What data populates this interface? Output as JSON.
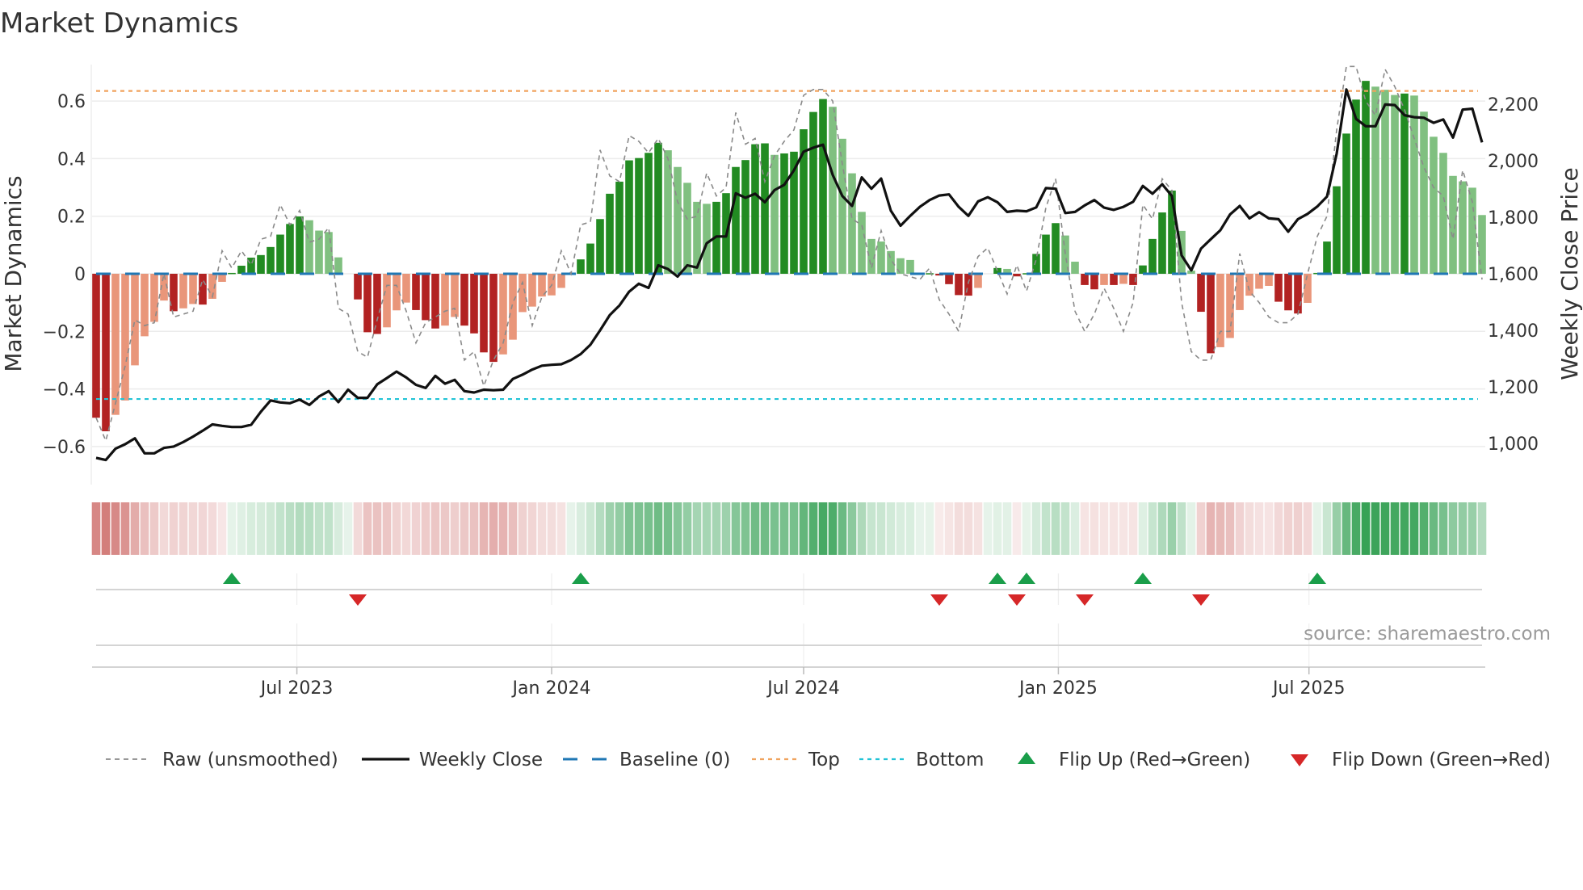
{
  "title": "Market Dynamics",
  "source": "source: sharemaestro.com",
  "chart_data": {
    "type": "bar",
    "title": "Market Dynamics",
    "ylabel": "Market Dynamics",
    "y2label": "Weekly Close Price",
    "ylim": [
      -0.7,
      0.75
    ],
    "y2lim": [
      900,
      2330
    ],
    "start_date": "2023-02-06",
    "interval": "weekly",
    "top_level": 0.635,
    "bottom_level": -0.435,
    "baseline": 0,
    "grid": "horizontal",
    "left_ticks": [
      {
        "value": -0.6,
        "label": "−0.6"
      },
      {
        "value": -0.4,
        "label": "−0.4"
      },
      {
        "value": -0.2,
        "label": "−0.2"
      },
      {
        "value": 0,
        "label": "0"
      },
      {
        "value": 0.2,
        "label": "0.2"
      },
      {
        "value": 0.4,
        "label": "0.4"
      },
      {
        "value": 0.6,
        "label": "0.6"
      }
    ],
    "right_ticks": [
      {
        "value": 1000,
        "label": "1,000"
      },
      {
        "value": 1200,
        "label": "1,200"
      },
      {
        "value": 1400,
        "label": "1,400"
      },
      {
        "value": 1600,
        "label": "1,600"
      },
      {
        "value": 1800,
        "label": "1,800"
      },
      {
        "value": 2000,
        "label": "2,000"
      },
      {
        "value": 2200,
        "label": "2,200"
      }
    ],
    "x_ticks": [
      {
        "date": "2023-07-01",
        "label": "Jul 2023"
      },
      {
        "date": "2024-01-01",
        "label": "Jan 2024"
      },
      {
        "date": "2024-07-01",
        "label": "Jul 2024"
      },
      {
        "date": "2025-01-01",
        "label": "Jan 2025"
      },
      {
        "date": "2025-07-01",
        "label": "Jul 2025"
      }
    ],
    "momentum": [
      -0.5,
      -0.547,
      -0.49,
      -0.44,
      -0.318,
      -0.217,
      -0.167,
      -0.093,
      -0.13,
      -0.12,
      -0.105,
      -0.107,
      -0.087,
      -0.028,
      0.003,
      0.028,
      0.056,
      0.065,
      0.093,
      0.136,
      0.173,
      0.199,
      0.186,
      0.15,
      0.145,
      0.057,
      0.0,
      -0.089,
      -0.203,
      -0.209,
      -0.186,
      -0.127,
      -0.1,
      -0.126,
      -0.161,
      -0.19,
      -0.18,
      -0.15,
      -0.18,
      -0.207,
      -0.273,
      -0.306,
      -0.28,
      -0.229,
      -0.133,
      -0.114,
      -0.079,
      -0.075,
      -0.049,
      0.0,
      0.05,
      0.105,
      0.19,
      0.278,
      0.32,
      0.394,
      0.402,
      0.42,
      0.455,
      0.429,
      0.371,
      0.316,
      0.25,
      0.243,
      0.25,
      0.28,
      0.371,
      0.395,
      0.45,
      0.453,
      0.413,
      0.418,
      0.424,
      0.502,
      0.562,
      0.607,
      0.58,
      0.469,
      0.349,
      0.215,
      0.121,
      0.112,
      0.079,
      0.054,
      0.048,
      0.0,
      0.002,
      -0.006,
      -0.036,
      -0.074,
      -0.076,
      -0.049,
      0.0,
      0.02,
      0.017,
      -0.009,
      0.002,
      0.069,
      0.136,
      0.176,
      0.133,
      0.042,
      -0.039,
      -0.054,
      -0.039,
      -0.039,
      -0.035,
      -0.039,
      0.029,
      0.121,
      0.213,
      0.289,
      0.149,
      0.011,
      -0.132,
      -0.276,
      -0.255,
      -0.223,
      -0.126,
      -0.076,
      -0.052,
      -0.042,
      -0.097,
      -0.127,
      -0.138,
      -0.101,
      0.003,
      0.112,
      0.304,
      0.487,
      0.605,
      0.67,
      0.65,
      0.639,
      0.621,
      0.626,
      0.619,
      0.563,
      0.476,
      0.42,
      0.34,
      0.321,
      0.299,
      0.204
    ],
    "raw": [
      -0.5,
      -0.58,
      -0.45,
      -0.32,
      -0.16,
      -0.18,
      -0.17,
      0.0,
      -0.15,
      -0.14,
      -0.13,
      -0.02,
      -0.08,
      0.08,
      0.02,
      0.08,
      0.03,
      0.12,
      0.13,
      0.24,
      0.17,
      0.22,
      0.11,
      0.12,
      0.16,
      -0.12,
      -0.14,
      -0.27,
      -0.29,
      -0.16,
      -0.04,
      -0.04,
      -0.13,
      -0.24,
      -0.17,
      -0.15,
      -0.13,
      -0.12,
      -0.3,
      -0.27,
      -0.39,
      -0.3,
      -0.24,
      -0.1,
      -0.03,
      -0.18,
      -0.08,
      -0.04,
      0.08,
      0.0,
      0.17,
      0.18,
      0.43,
      0.34,
      0.32,
      0.48,
      0.46,
      0.42,
      0.47,
      0.4,
      0.25,
      0.19,
      0.2,
      0.35,
      0.27,
      0.3,
      0.56,
      0.45,
      0.47,
      0.32,
      0.41,
      0.46,
      0.5,
      0.62,
      0.64,
      0.64,
      0.6,
      0.38,
      0.19,
      0.17,
      0.02,
      0.15,
      0.05,
      0.0,
      -0.01,
      -0.02,
      0.02,
      -0.09,
      -0.14,
      -0.2,
      -0.03,
      0.06,
      0.09,
      0.01,
      -0.07,
      0.03,
      -0.06,
      0.05,
      0.23,
      0.33,
      0.07,
      -0.13,
      -0.2,
      -0.14,
      -0.05,
      -0.12,
      -0.2,
      -0.1,
      0.24,
      0.19,
      0.33,
      0.29,
      -0.1,
      -0.27,
      -0.3,
      -0.3,
      -0.2,
      -0.2,
      0.07,
      -0.06,
      -0.1,
      -0.15,
      -0.17,
      -0.17,
      -0.14,
      0.0,
      0.13,
      0.2,
      0.5,
      0.72,
      0.72,
      0.6,
      0.55,
      0.71,
      0.65,
      0.57,
      0.47,
      0.37,
      0.3,
      0.27,
      0.12,
      0.36,
      0.25,
      -0.02
    ],
    "close": [
      949,
      941,
      981,
      997,
      1018,
      965,
      965,
      984,
      989,
      1005,
      1024,
      1045,
      1067,
      1062,
      1058,
      1058,
      1066,
      1112,
      1152,
      1145,
      1142,
      1155,
      1136,
      1166,
      1185,
      1146,
      1190,
      1161,
      1161,
      1209,
      1231,
      1254,
      1233,
      1207,
      1196,
      1239,
      1211,
      1225,
      1185,
      1180,
      1190,
      1188,
      1190,
      1228,
      1243,
      1261,
      1275,
      1278,
      1280,
      1295,
      1316,
      1349,
      1400,
      1454,
      1488,
      1537,
      1565,
      1550,
      1630,
      1617,
      1590,
      1630,
      1622,
      1708,
      1732,
      1732,
      1885,
      1869,
      1883,
      1853,
      1896,
      1915,
      1966,
      2032,
      2046,
      2057,
      1950,
      1875,
      1840,
      1941,
      1901,
      1937,
      1823,
      1770,
      1805,
      1837,
      1861,
      1877,
      1881,
      1837,
      1805,
      1856,
      1871,
      1853,
      1819,
      1823,
      1821,
      1835,
      1903,
      1901,
      1815,
      1819,
      1842,
      1861,
      1834,
      1826,
      1837,
      1855,
      1911,
      1883,
      1917,
      1875,
      1665,
      1612,
      1689,
      1722,
      1754,
      1810,
      1840,
      1796,
      1818,
      1796,
      1793,
      1749,
      1793,
      1812,
      1838,
      1873,
      2025,
      2252,
      2148,
      2122,
      2122,
      2199,
      2197,
      2161,
      2154,
      2152,
      2134,
      2146,
      2082,
      2181,
      2184,
      2065
    ],
    "flip_up_weeks": [
      15,
      51,
      94,
      97,
      109,
      127
    ],
    "flip_down_weeks": [
      28,
      88,
      96,
      103,
      115
    ],
    "legend_position": "bottom",
    "legend": [
      {
        "key": "raw",
        "label": "Raw (unsmoothed)"
      },
      {
        "key": "close",
        "label": "Weekly Close"
      },
      {
        "key": "baseline",
        "label": "Baseline (0)"
      },
      {
        "key": "top",
        "label": "Top"
      },
      {
        "key": "bottom",
        "label": "Bottom"
      },
      {
        "key": "flip_up",
        "label": "Flip Up (Red→Green)"
      },
      {
        "key": "flip_down",
        "label": "Flip Down (Green→Red)"
      }
    ],
    "colors": {
      "green_dark": "#228b22",
      "green_light": "#80c080",
      "red_dark": "#b22222",
      "red_light": "#e9967a",
      "close": "#111111",
      "raw": "#8a8a8a",
      "baseline": "#1f77b4",
      "top": "#f0a35e",
      "bottom": "#22c3d6",
      "flip_up": "#1a9e4a",
      "flip_down": "#d62728"
    }
  }
}
